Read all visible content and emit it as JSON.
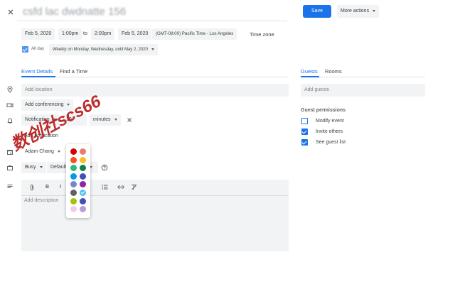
{
  "header": {
    "close_icon": "close-icon",
    "title": "csfd lac dwdnatte 156",
    "save_label": "Save",
    "more_actions_label": "More actions"
  },
  "datetime": {
    "start_date": "Feb 5, 2020",
    "start_time": "1:00pm",
    "to": "to",
    "end_time": "2:00pm",
    "end_date": "Feb 5, 2020",
    "timezone": "(GMT-08:00) Pacific Time - Los Angeles",
    "timezone_link": "Time zone",
    "all_day_label": "All day",
    "all_day_checked": true,
    "recurrence": "Weekly on Monday, Wednesday, until May 2, 2020"
  },
  "tabs": {
    "event_details": "Event Details",
    "find_a_time": "Find a Time"
  },
  "details": {
    "location_placeholder": "Add location",
    "conferencing_label": "Add conferencing",
    "notification_type": "Notification",
    "notification_value": "10",
    "notification_unit": "minutes",
    "add_notification": "Add notification",
    "calendar_owner": "Adam Chang",
    "availability": "Busy",
    "visibility": "Default",
    "description_placeholder": "Add description"
  },
  "color_picker": {
    "selected_index": 11,
    "colors": [
      "#d50000",
      "#e67c73",
      "#f4511e",
      "#f6bf26",
      "#33b679",
      "#0b8043",
      "#039be5",
      "#3f51b5",
      "#7986cb",
      "#8e24aa",
      "#616161",
      "#4fc3f7",
      "#a0c40a",
      "#3f51b5",
      "#f8c8e8",
      "#b39ddb"
    ]
  },
  "guests": {
    "tab_guests": "Guests",
    "tab_rooms": "Rooms",
    "add_guests_placeholder": "Add guests",
    "permissions_title": "Guest permissions",
    "permissions": [
      {
        "label": "Modify event",
        "checked": false
      },
      {
        "label": "Invite others",
        "checked": true
      },
      {
        "label": "See guest list",
        "checked": true
      }
    ]
  },
  "watermark": "数创社scs66",
  "colors": {
    "accent": "#1a73e8",
    "chip_bg": "#f1f3f4",
    "watermark": "#b71c1c"
  }
}
